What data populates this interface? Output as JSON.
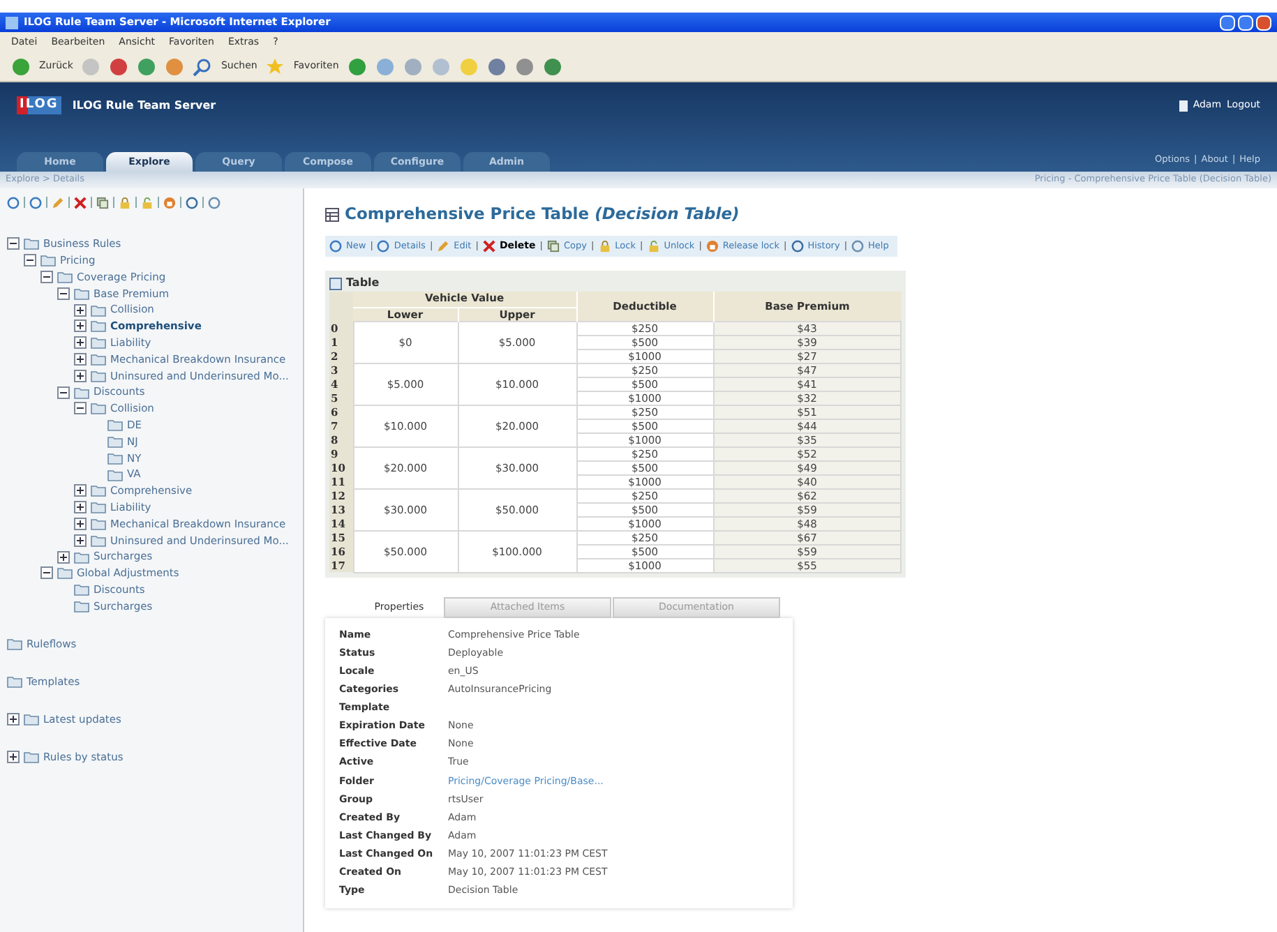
{
  "window": {
    "title": "ILOG Rule Team Server - Microsoft Internet Explorer"
  },
  "menu": [
    "Datei",
    "Bearbeiten",
    "Ansicht",
    "Favoriten",
    "Extras",
    "?"
  ],
  "browser_toolbar": {
    "back": "Zurück",
    "search": "Suchen",
    "favorites": "Favoriten"
  },
  "header": {
    "logo": "ILOG",
    "product": "ILOG Rule Team Server",
    "user": "Adam",
    "logout": "Logout",
    "links": [
      "Options",
      "About",
      "Help"
    ],
    "separator": "|"
  },
  "tabs": [
    {
      "label": "Home",
      "selected": false
    },
    {
      "label": "Explore",
      "selected": true
    },
    {
      "label": "Query",
      "selected": false
    },
    {
      "label": "Compose",
      "selected": false
    },
    {
      "label": "Configure",
      "selected": false
    },
    {
      "label": "Admin",
      "selected": false
    }
  ],
  "breadcrumb": "Explore > Details",
  "location": "Pricing - Comprehensive Price Table (Decision Table)",
  "tree": [
    {
      "label": "Business Rules",
      "expanded": true,
      "children": [
        {
          "label": "Pricing",
          "expanded": true,
          "children": [
            {
              "label": "Coverage Pricing",
              "expanded": true,
              "children": [
                {
                  "label": "Base Premium",
                  "expanded": true,
                  "children": [
                    {
                      "label": "Collision",
                      "expanded": false
                    },
                    {
                      "label": "Comprehensive",
                      "expanded": false,
                      "selected": true
                    },
                    {
                      "label": "Liability",
                      "expanded": false
                    },
                    {
                      "label": "Mechanical Breakdown Insurance",
                      "expanded": false
                    },
                    {
                      "label": "Uninsured and Underinsured Mo...",
                      "expanded": false
                    }
                  ]
                },
                {
                  "label": "Discounts",
                  "expanded": true,
                  "children": [
                    {
                      "label": "Collision",
                      "expanded": true,
                      "children": [
                        {
                          "label": "DE"
                        },
                        {
                          "label": "NJ"
                        },
                        {
                          "label": "NY"
                        },
                        {
                          "label": "VA"
                        }
                      ]
                    },
                    {
                      "label": "Comprehensive",
                      "expanded": false
                    },
                    {
                      "label": "Liability",
                      "expanded": false
                    },
                    {
                      "label": "Mechanical Breakdown Insurance",
                      "expanded": false
                    },
                    {
                      "label": "Uninsured and Underinsured Mo...",
                      "expanded": false
                    }
                  ]
                },
                {
                  "label": "Surcharges",
                  "expanded": false
                }
              ]
            },
            {
              "label": "Global Adjustments",
              "expanded": true,
              "children": [
                {
                  "label": "Discounts"
                },
                {
                  "label": "Surcharges"
                }
              ]
            }
          ]
        }
      ]
    }
  ],
  "sections": [
    {
      "label": "Ruleflows"
    },
    {
      "label": "Templates"
    },
    {
      "label": "Latest updates",
      "expanded": false
    },
    {
      "label": "Rules by status",
      "expanded": false
    }
  ],
  "title": {
    "name": "Comprehensive Price Table",
    "type": "(Decision Table)"
  },
  "actions": [
    {
      "label": "New",
      "kind": "link"
    },
    {
      "label": "Details",
      "kind": "link"
    },
    {
      "label": "Edit",
      "kind": "link"
    },
    {
      "label": "Delete",
      "kind": "danger"
    },
    {
      "label": "Copy",
      "kind": "link"
    },
    {
      "label": "Lock",
      "kind": "link"
    },
    {
      "label": "Unlock",
      "kind": "link"
    },
    {
      "label": "Release lock",
      "kind": "link"
    },
    {
      "label": "History",
      "kind": "link"
    },
    {
      "label": "Help",
      "kind": "link"
    }
  ],
  "action_separator": "|",
  "table": {
    "title": "Table",
    "group_heading": "Vehicle Value",
    "columns": [
      "Lower",
      "Upper",
      "Deductible",
      "Base Premium"
    ],
    "groups": [
      {
        "lower": "$0",
        "upper": "$5.000",
        "rows": [
          {
            "index": "0",
            "deductible": "$250",
            "premium": "$43"
          },
          {
            "index": "1",
            "deductible": "$500",
            "premium": "$39"
          },
          {
            "index": "2",
            "deductible": "$1000",
            "premium": "$27"
          }
        ]
      },
      {
        "lower": "$5.000",
        "upper": "$10.000",
        "rows": [
          {
            "index": "3",
            "deductible": "$250",
            "premium": "$47"
          },
          {
            "index": "4",
            "deductible": "$500",
            "premium": "$41"
          },
          {
            "index": "5",
            "deductible": "$1000",
            "premium": "$32"
          }
        ]
      },
      {
        "lower": "$10.000",
        "upper": "$20.000",
        "rows": [
          {
            "index": "6",
            "deductible": "$250",
            "premium": "$51"
          },
          {
            "index": "7",
            "deductible": "$500",
            "premium": "$44"
          },
          {
            "index": "8",
            "deductible": "$1000",
            "premium": "$35"
          }
        ]
      },
      {
        "lower": "$20.000",
        "upper": "$30.000",
        "rows": [
          {
            "index": "9",
            "deductible": "$250",
            "premium": "$52"
          },
          {
            "index": "10",
            "deductible": "$500",
            "premium": "$49"
          },
          {
            "index": "11",
            "deductible": "$1000",
            "premium": "$40"
          }
        ]
      },
      {
        "lower": "$30.000",
        "upper": "$50.000",
        "rows": [
          {
            "index": "12",
            "deductible": "$250",
            "premium": "$62"
          },
          {
            "index": "13",
            "deductible": "$500",
            "premium": "$59"
          },
          {
            "index": "14",
            "deductible": "$1000",
            "premium": "$48"
          }
        ]
      },
      {
        "lower": "$50.000",
        "upper": "$100.000",
        "rows": [
          {
            "index": "15",
            "deductible": "$250",
            "premium": "$67"
          },
          {
            "index": "16",
            "deductible": "$500",
            "premium": "$59"
          },
          {
            "index": "17",
            "deductible": "$1000",
            "premium": "$55"
          }
        ]
      }
    ]
  },
  "detail_tabs": [
    {
      "label": "Properties",
      "selected": true
    },
    {
      "label": "Attached Items",
      "selected": false
    },
    {
      "label": "Documentation",
      "selected": false
    }
  ],
  "properties": [
    {
      "label": "Name",
      "value": "Comprehensive Price Table"
    },
    {
      "label": "Status",
      "value": "Deployable"
    },
    {
      "label": "Locale",
      "value": "en_US"
    },
    {
      "label": "Categories",
      "value": "AutoInsurancePricing"
    },
    {
      "label": "Template"
    },
    {
      "label": "Expiration Date",
      "value": "None"
    },
    {
      "label": "Effective Date",
      "value": "None"
    },
    {
      "label": "Active",
      "value": "True"
    },
    {
      "label": "Folder",
      "value": "Pricing/Coverage Pricing/Base...",
      "kind": "link"
    },
    {
      "label": "Group",
      "value": "rtsUser"
    },
    {
      "label": "Created By",
      "value": "Adam"
    },
    {
      "label": "Last Changed By",
      "value": "Adam"
    },
    {
      "label": "Last Changed On",
      "value": "May 10, 2007 11:01:23 PM CEST"
    },
    {
      "label": "Created On",
      "value": "May 10, 2007 11:01:23 PM CEST"
    },
    {
      "label": "Type",
      "value": "Decision Table"
    }
  ]
}
